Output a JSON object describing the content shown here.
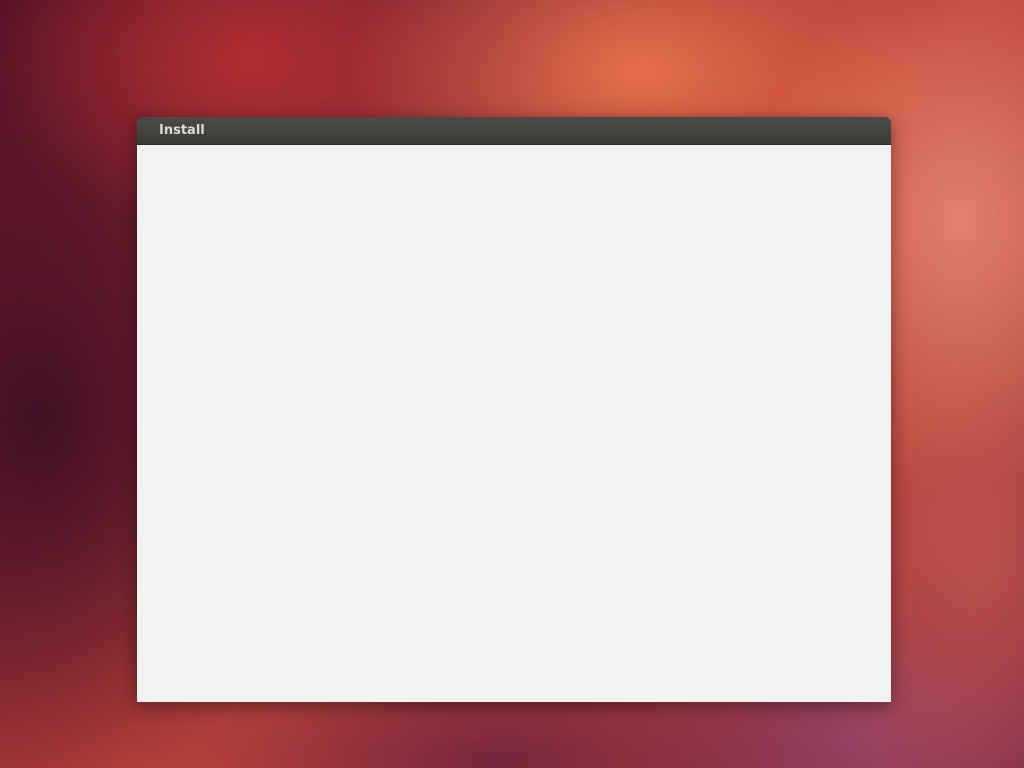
{
  "desktop": {
    "wallpaper_colors": [
      "#5a1426",
      "#c4473a",
      "#f07850",
      "#7a2a45"
    ]
  },
  "window": {
    "title": "Install",
    "titlebar_color": "#3c3b37",
    "content_color": "#f2f1f0"
  }
}
